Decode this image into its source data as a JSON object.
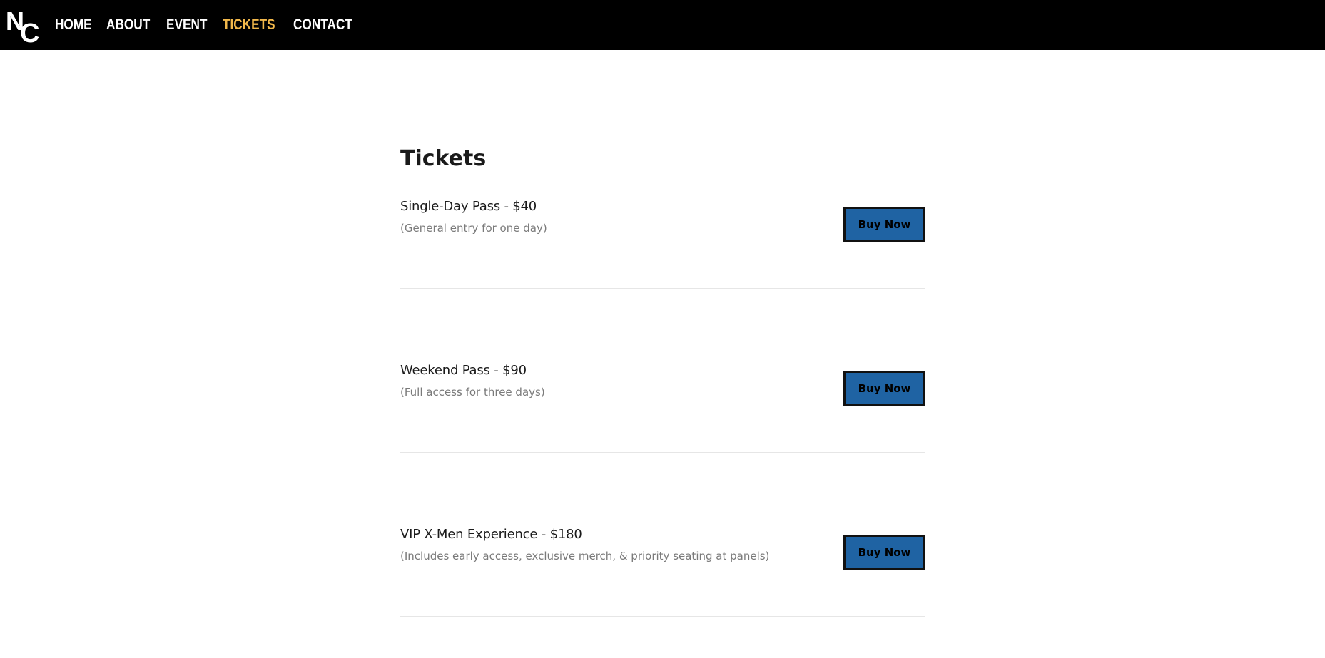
{
  "brand": {
    "logo_letter_1": "N",
    "logo_letter_2": "C"
  },
  "nav": {
    "items": [
      {
        "label": "HOME",
        "active": false
      },
      {
        "label": "ABOUT",
        "active": false
      },
      {
        "label": "EVENT",
        "active": false
      },
      {
        "label": "TICKETS",
        "active": true
      },
      {
        "label": "CONTACT",
        "active": false
      }
    ]
  },
  "main": {
    "title": "Tickets",
    "tickets": [
      {
        "name": "Single-Day Pass - $40",
        "description": "(General entry for one day)",
        "button_label": "Buy Now"
      },
      {
        "name": "Weekend Pass - $90",
        "description": "(Full access for three days)",
        "button_label": "Buy Now"
      },
      {
        "name": "VIP X-Men Experience - $180",
        "description": "(Includes early access, exclusive merch, & priority seating at panels)",
        "button_label": "Buy Now"
      }
    ]
  },
  "colors": {
    "nav_background": "#000000",
    "nav_active": "#f2b84b",
    "button_background": "#1f63a3",
    "button_border": "#111111"
  }
}
